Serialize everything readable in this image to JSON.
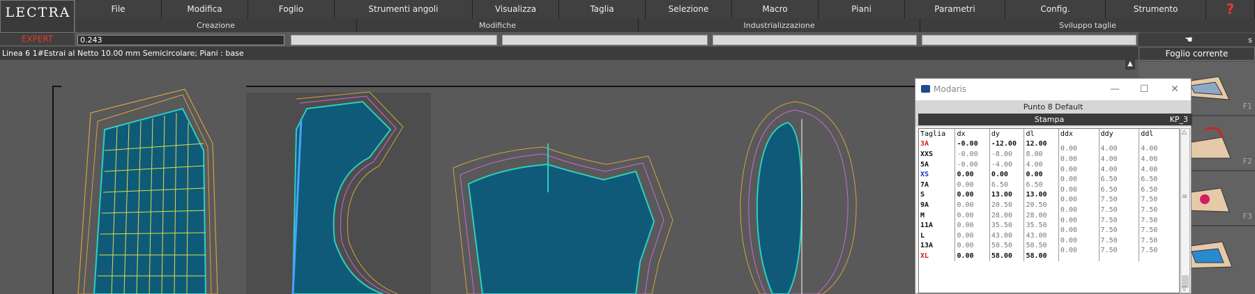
{
  "app": {
    "logo": "LECTRA",
    "mode": "EXPERT"
  },
  "menu": [
    "File",
    "Modifica",
    "Foglio",
    "Strumenti angoli",
    "Visualizza",
    "Taglia",
    "Selezione",
    "Macro",
    "Piani",
    "Parametri",
    "Config.",
    "Strumento"
  ],
  "help_glyph": "?",
  "groups": [
    "Creazione",
    "Modifiche",
    "Industrializzazione",
    "Sviluppo taglie"
  ],
  "input": {
    "value": "0.243"
  },
  "status": "Linea 6 1#Estrai al Netto 10.00 mm Semicircolare;   Piani :  base",
  "right_panel": {
    "cursor_letter": "s",
    "sheet_label": "Foglio corrente",
    "keys": [
      "F1",
      "F2",
      "F3"
    ]
  },
  "dialog": {
    "title": "Modaris",
    "point": "Punto 8 Default",
    "print_label": "Stampa",
    "code": "KP_3",
    "columns": [
      "Taglia",
      "dx",
      "dy",
      "dl",
      "ddx",
      "ddy",
      "ddl"
    ],
    "rows": [
      {
        "size": "3A",
        "dx": "-0.00",
        "dy": "-12.00",
        "dl": "12.00",
        "c": "red",
        "b": true
      },
      {
        "size": "XXS",
        "dx": "-0.00",
        "dy": "-8.00",
        "dl": "8.00",
        "c": "black",
        "b": false
      },
      {
        "size": "5A",
        "dx": "-0.00",
        "dy": "-4.00",
        "dl": "4.00",
        "c": "black",
        "b": false
      },
      {
        "size": "XS",
        "dx": "0.00",
        "dy": "0.00",
        "dl": "0.00",
        "c": "blue",
        "b": true
      },
      {
        "size": "7A",
        "dx": "0.00",
        "dy": "6.50",
        "dl": "6.50",
        "c": "black",
        "b": false
      },
      {
        "size": "S",
        "dx": "0.00",
        "dy": "13.00",
        "dl": "13.00",
        "c": "black",
        "b": true
      },
      {
        "size": "9A",
        "dx": "0.00",
        "dy": "20.50",
        "dl": "20.50",
        "c": "black",
        "b": false
      },
      {
        "size": "M",
        "dx": "0.00",
        "dy": "28.00",
        "dl": "28.00",
        "c": "black",
        "b": false
      },
      {
        "size": "11A",
        "dx": "0.00",
        "dy": "35.50",
        "dl": "35.50",
        "c": "black",
        "b": false
      },
      {
        "size": "L",
        "dx": "0.00",
        "dy": "43.00",
        "dl": "43.00",
        "c": "black",
        "b": false
      },
      {
        "size": "13A",
        "dx": "0.00",
        "dy": "50.50",
        "dl": "50.50",
        "c": "black",
        "b": false
      },
      {
        "size": "XL",
        "dx": "0.00",
        "dy": "58.00",
        "dl": "58.00",
        "c": "red",
        "b": true
      }
    ],
    "ddx": [
      "0.00",
      "0.00",
      "0.00",
      "0.00",
      "0.00",
      "0.00",
      "0.00",
      "0.00",
      "0.00",
      "0.00",
      "0.00"
    ],
    "ddy": [
      "4.00",
      "4.00",
      "4.00",
      "6.50",
      "6.50",
      "7.50",
      "7.50",
      "7.50",
      "7.50",
      "7.50",
      "7.50"
    ],
    "ddl": [
      "4.00",
      "4.00",
      "4.00",
      "6.50",
      "6.50",
      "7.50",
      "7.50",
      "7.50",
      "7.50",
      "7.50",
      "7.50"
    ]
  },
  "colors": {
    "accent_red": "#e23a2a",
    "piece_fill": "#0f5a78"
  }
}
